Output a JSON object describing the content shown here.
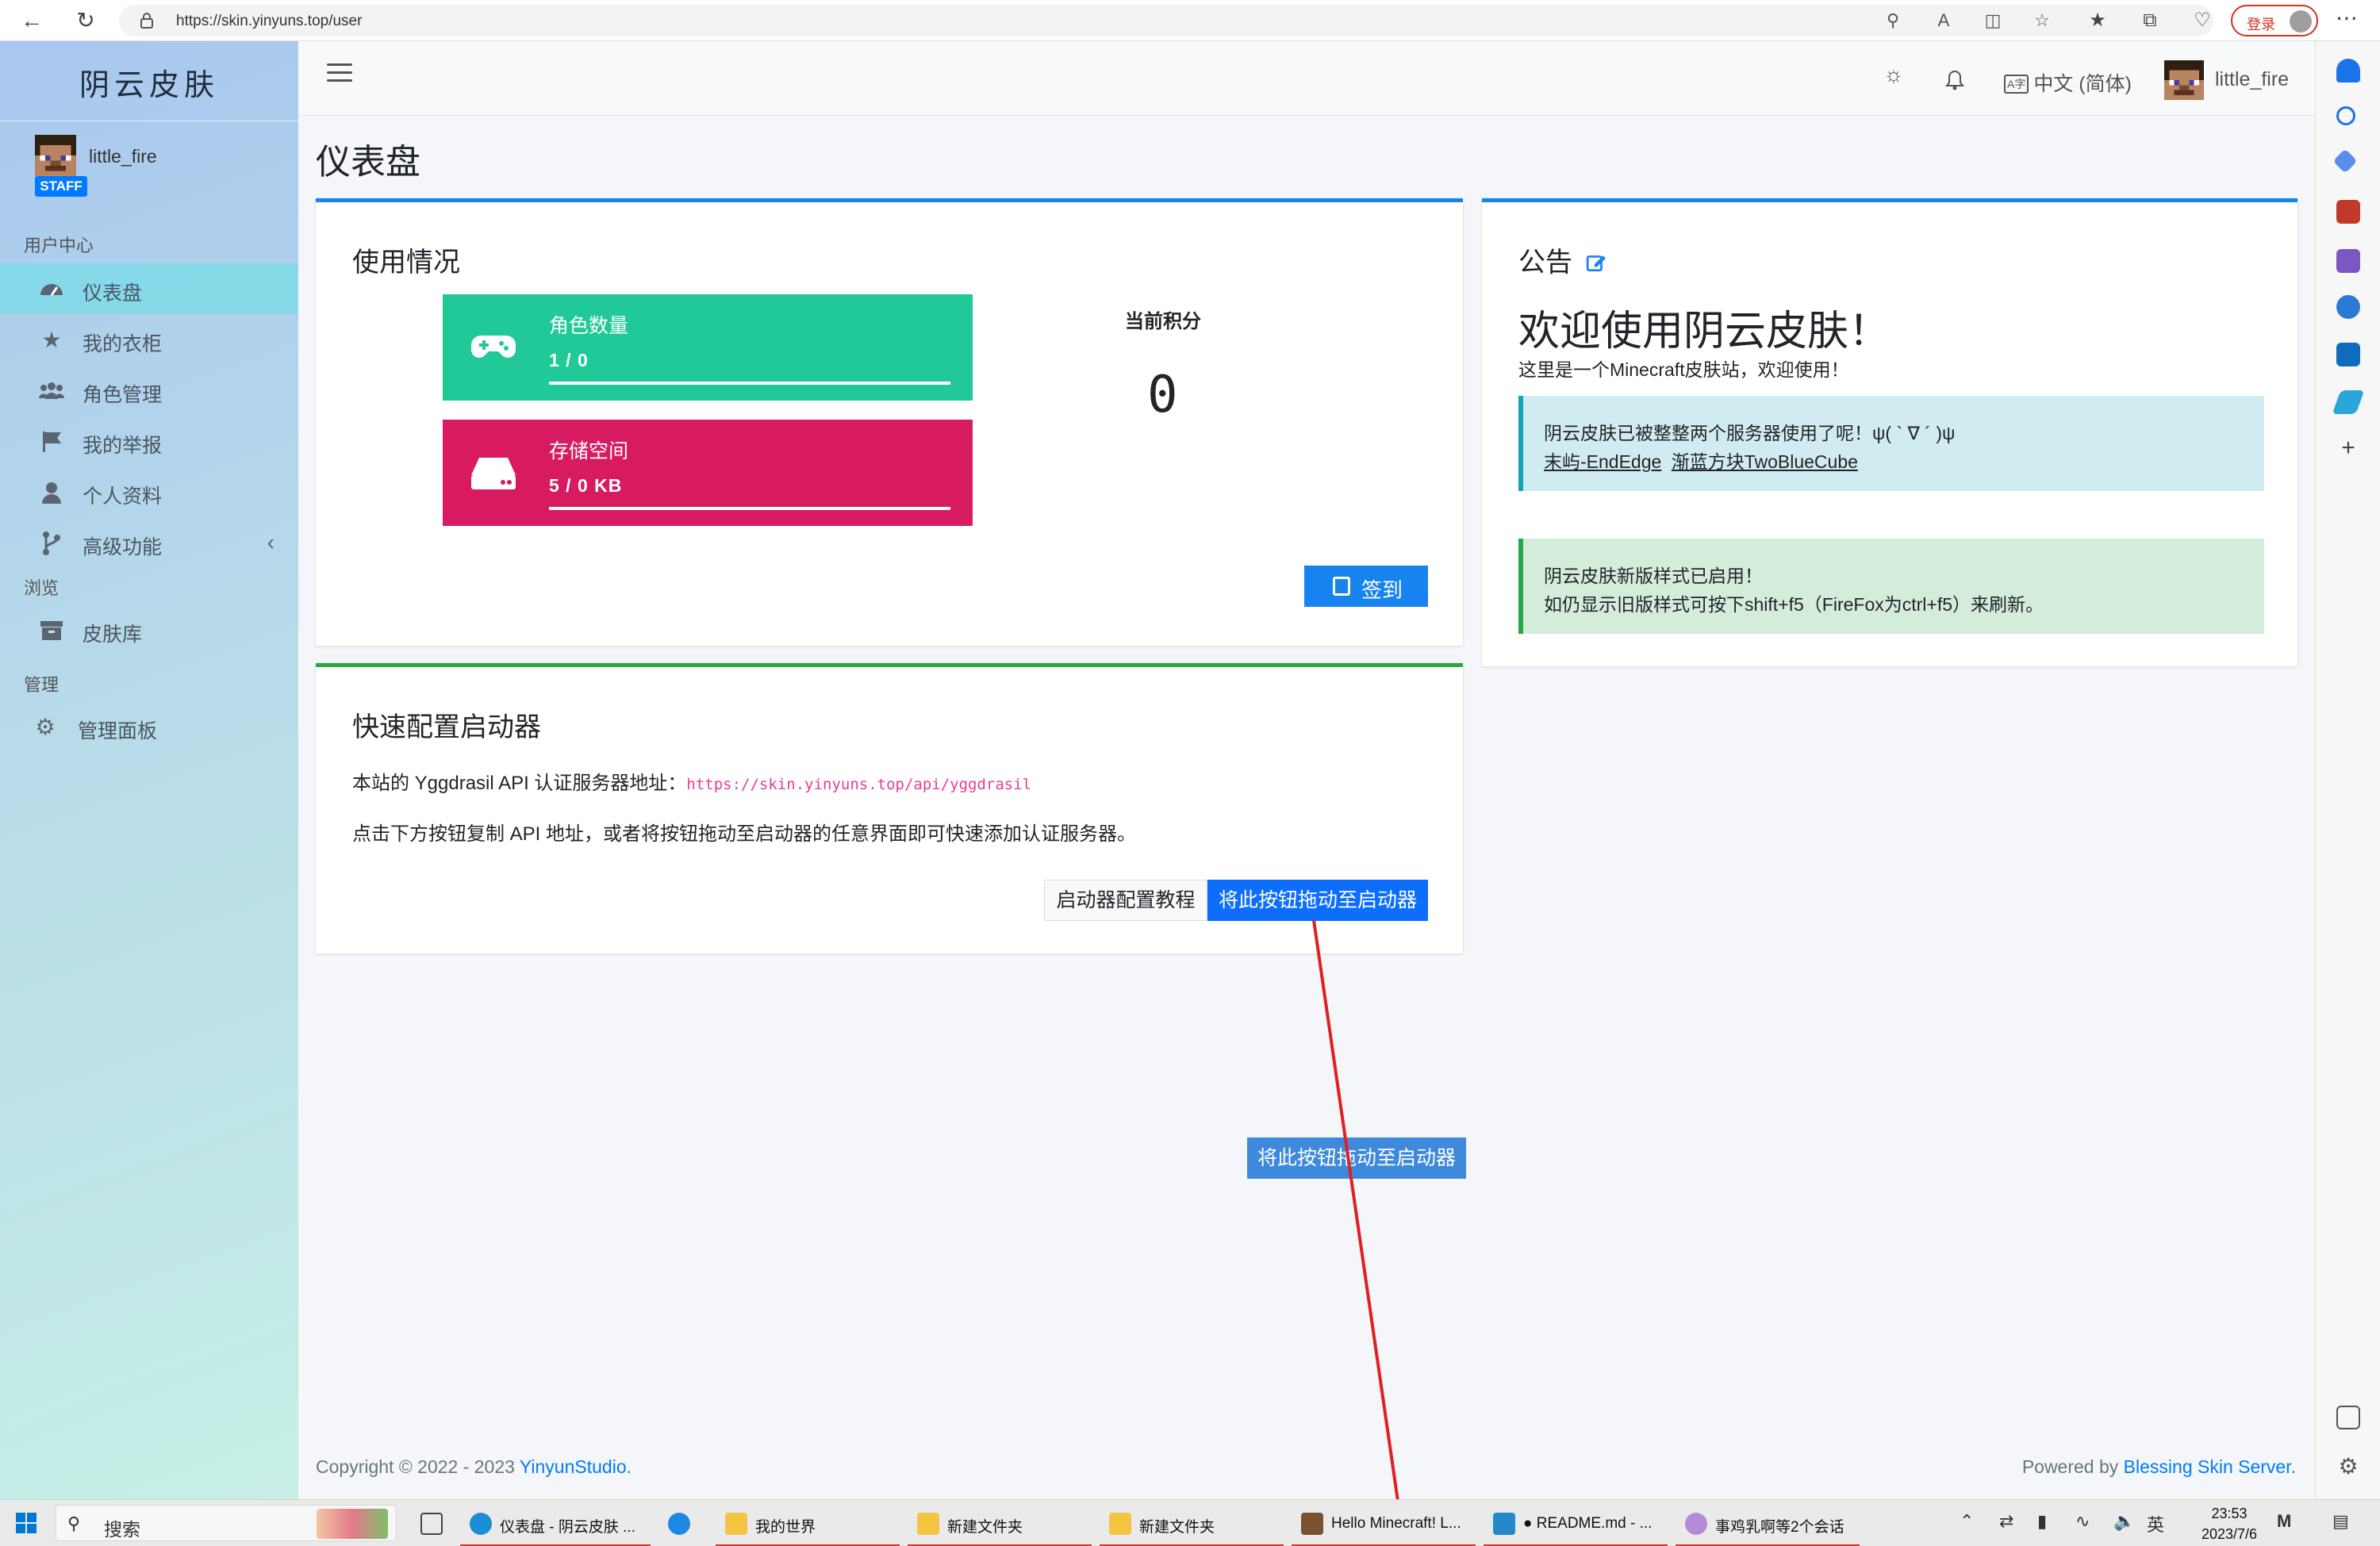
{
  "browser": {
    "url": "https://skin.yinyuns.top/user",
    "login_label": "登录"
  },
  "sidebar": {
    "brand": "阴云皮肤",
    "user": {
      "name": "little_fire",
      "badge": "STAFF"
    },
    "headers": {
      "user_center": "用户中心",
      "browse": "浏览",
      "manage": "管理"
    },
    "items": [
      {
        "label": "仪表盘",
        "icon": "dashboard-icon",
        "active": true
      },
      {
        "label": "我的衣柜",
        "icon": "star-icon"
      },
      {
        "label": "角色管理",
        "icon": "users-icon"
      },
      {
        "label": "我的举报",
        "icon": "flag-icon"
      },
      {
        "label": "个人资料",
        "icon": "user-icon"
      },
      {
        "label": "高级功能",
        "icon": "branch-icon"
      },
      {
        "label": "皮肤库",
        "icon": "archive-icon"
      },
      {
        "label": "管理面板",
        "icon": "gear-icon"
      }
    ]
  },
  "topnav": {
    "language": "中文 (简体)",
    "username": "little_fire"
  },
  "page": {
    "title": "仪表盘"
  },
  "usage": {
    "title": "使用情况",
    "players": {
      "label": "角色数量",
      "value": "1 / 0",
      "color": "#20c997"
    },
    "storage": {
      "label": "存储空间",
      "value": "5 / 0 KB",
      "color": "#d81b60"
    },
    "score_label": "当前积分",
    "score_value": "0",
    "signin_label": "签到"
  },
  "launcher": {
    "title": "快速配置启动器",
    "api_prefix": "本站的 Yggdrasil API 认证服务器地址：",
    "api_url": "https://skin.yinyuns.top/api/yggdrasil",
    "description": "点击下方按钮复制 API 地址，或者将按钮拖动至启动器的任意界面即可快速添加认证服务器。",
    "tutorial_label": "启动器配置教程",
    "drag_label": "将此按钮拖动至启动器"
  },
  "drag_ghost_label": "将此按钮拖动至启动器",
  "notice": {
    "title": "公告",
    "heading": "欢迎使用阴云皮肤！",
    "subtitle": "这里是一个Minecraft皮肤站，欢迎使用！",
    "info_line1": "阴云皮肤已被整整两个服务器使用了呢！ψ( ` ∇ ´ )ψ",
    "info_link1": "末屿-EndEdge",
    "info_link2": "渐蓝方块TwoBlueCube",
    "success_line1": "阴云皮肤新版样式已启用！",
    "success_line2": "如仍显示旧版样式可按下shift+f5（FireFox为ctrl+f5）来刷新。"
  },
  "footer": {
    "copyright_prefix": "Copyright © 2022 - 2023 ",
    "copyright_link": "YinyunStudio.",
    "powered_prefix": "Powered by ",
    "powered_link": "Blessing Skin Server."
  },
  "taskbar": {
    "search_label": "搜索",
    "apps": [
      {
        "label": "仪表盘 - 阴云皮肤 ..."
      },
      {
        "label": ""
      },
      {
        "label": "我的世界"
      },
      {
        "label": "新建文件夹"
      },
      {
        "label": "新建文件夹"
      },
      {
        "label": "Hello Minecraft! L..."
      },
      {
        "label": "● README.md - ..."
      },
      {
        "label": "事鸡乳啊等2个会话"
      }
    ],
    "ime": "英",
    "time": "23:53",
    "date": "2023/7/6"
  }
}
